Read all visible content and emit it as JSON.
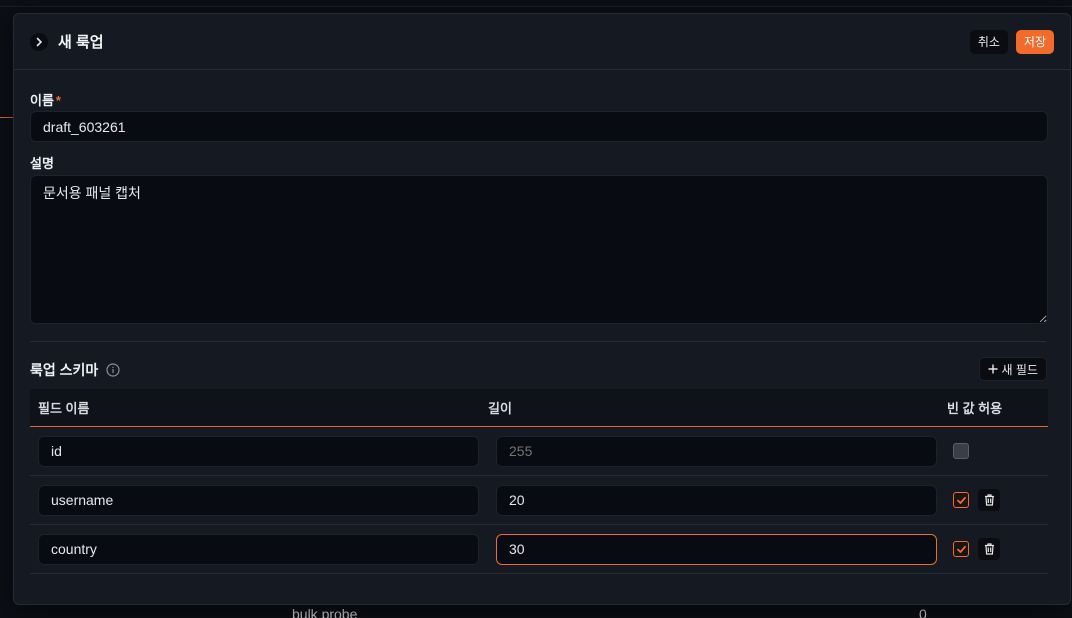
{
  "background": {
    "row_label": "bulk probe",
    "row_value": "0"
  },
  "panel": {
    "title": "새 룩업",
    "cancel_label": "취소",
    "save_label": "저장"
  },
  "form": {
    "name_label": "이름",
    "name_required_mark": "*",
    "name_value": "draft_603261",
    "description_label": "설명",
    "description_value": "문서용 패널 캡처"
  },
  "schema": {
    "title": "룩업 스키마",
    "new_field_label": "새 필드",
    "columns": [
      "필드 이름",
      "길이",
      "빈 값 허용"
    ],
    "rows": [
      {
        "name": "id",
        "length": "",
        "length_placeholder": "255",
        "nullable": false,
        "deletable": false
      },
      {
        "name": "username",
        "length": "20",
        "nullable": true,
        "deletable": true
      },
      {
        "name": "country",
        "length": "30",
        "nullable": true,
        "deletable": true
      }
    ]
  },
  "colors": {
    "accent": "#f26b2a",
    "panel_bg": "#141922",
    "input_bg": "#080b11"
  },
  "icons": {
    "collapse": "chevron-right-icon",
    "info": "info-icon",
    "add": "plus-icon",
    "delete": "trash-icon",
    "check": "check-icon"
  }
}
